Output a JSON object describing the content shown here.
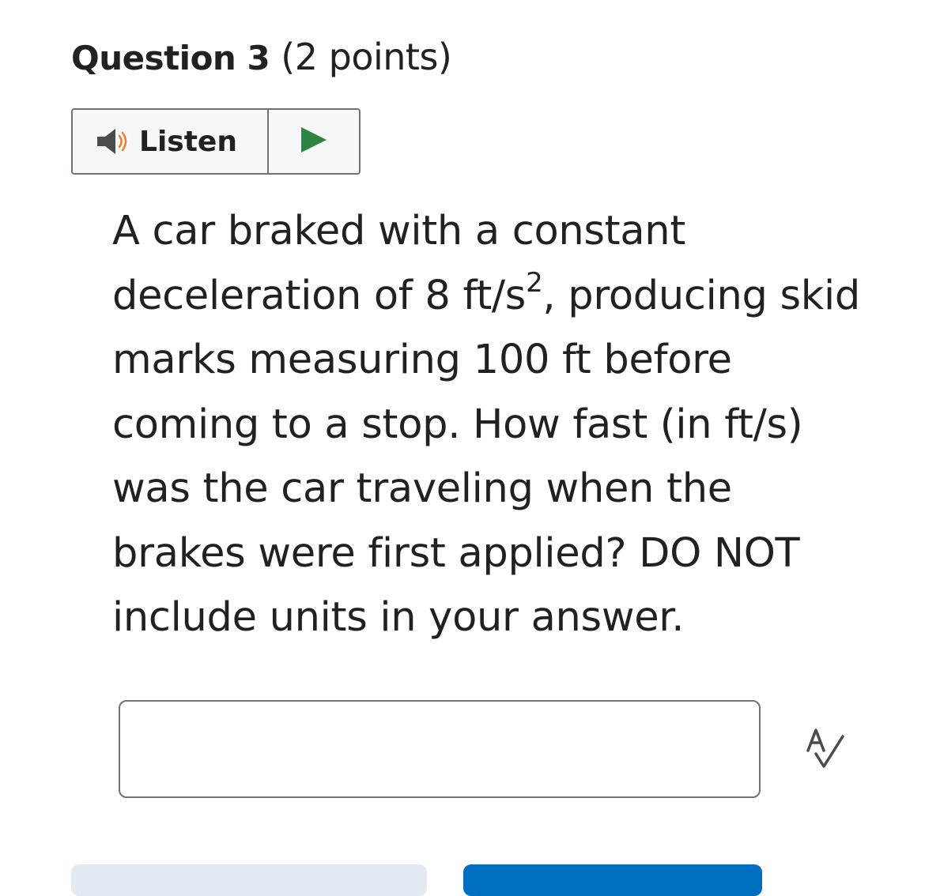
{
  "question": {
    "number_label": "Question 3",
    "points_label": "(2 points)"
  },
  "listen": {
    "label": "Listen",
    "speaker_icon": "speaker-icon",
    "play_icon": "play-icon",
    "colors": {
      "speaker_body": "#494c4e",
      "speaker_waves": "#f47d31",
      "play": "#2e8540"
    }
  },
  "prompt": {
    "text_before": "A car braked with a constant deceleration of 8 ft/s",
    "superscript": "2",
    "text_after": ", producing skid marks measuring 100 ft before coming to a stop. How fast (in ft/s) was the car traveling when the brakes were first applied?  DO NOT include units in your answer."
  },
  "answer": {
    "value": "",
    "placeholder": ""
  },
  "spellcheck": {
    "icon": "spellcheck-icon"
  },
  "colors": {
    "text": "#202122",
    "border": "#6e7376",
    "primary_button": "#006fbf",
    "secondary_button": "#e3e9f1"
  }
}
